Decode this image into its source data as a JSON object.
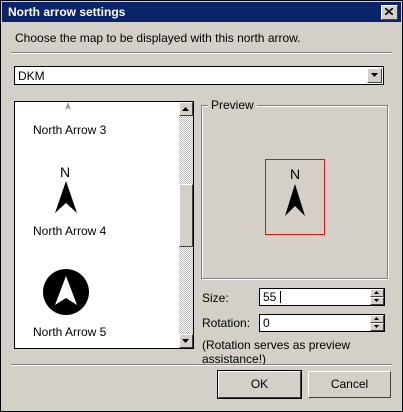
{
  "window": {
    "title": "North arrow settings"
  },
  "instruction": "Choose the map to be displayed with this north arrow.",
  "map_select": {
    "value": "DKM"
  },
  "arrow_list": {
    "items": [
      {
        "label": "North Arrow 3"
      },
      {
        "label": "North Arrow 4",
        "glyph": "N"
      },
      {
        "label": "North Arrow 5"
      }
    ]
  },
  "preview": {
    "legend": "Preview",
    "glyph": "N"
  },
  "size": {
    "label": "Size:",
    "value": "55"
  },
  "rotation": {
    "label": "Rotation:",
    "value": "0"
  },
  "note": "(Rotation serves as preview assistance!)",
  "buttons": {
    "ok": "OK",
    "cancel": "Cancel"
  },
  "colors": {
    "titlebar": "#0a246a",
    "preview_border": "#e01010"
  }
}
